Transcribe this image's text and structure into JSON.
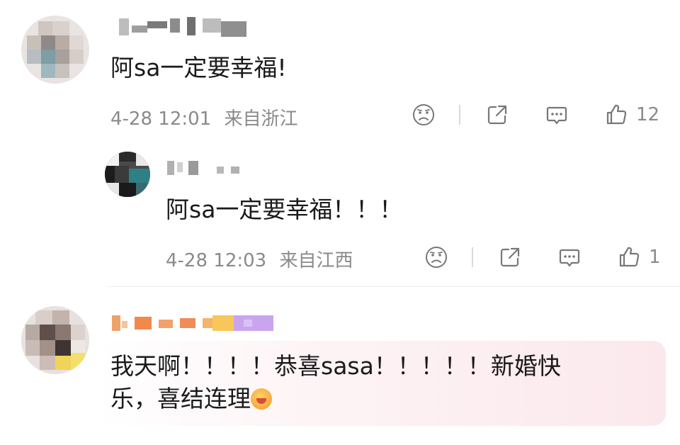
{
  "comments": [
    {
      "text": "阿sa一定要幸福!",
      "time": "4-28 12:01",
      "location": "来自浙江",
      "likes": "12"
    },
    {
      "text": "阿sa一定要幸福！！！",
      "time": "4-28 12:03",
      "location": "来自江西",
      "likes": "1"
    },
    {
      "text_line1": "我天啊！！！！恭喜sasa！！！！！新婚快",
      "text_line2": "乐，喜结连理"
    }
  ],
  "icons": {
    "dislike": "sad-face-icon",
    "share": "share-icon",
    "comment": "comment-bubble-icon",
    "like": "thumbs-up-icon",
    "emoji": "blush-emoji-icon"
  },
  "colors": {
    "meta_text": "#8a8a8a",
    "highlight_bg": "#fbe8ec"
  }
}
